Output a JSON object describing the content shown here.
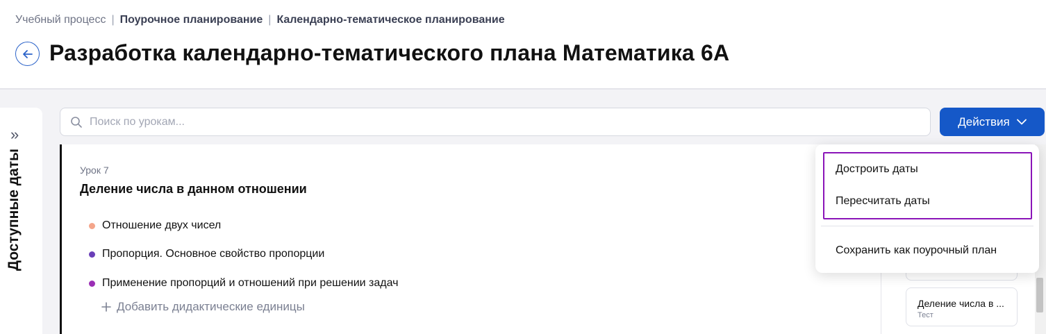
{
  "breadcrumb": {
    "items": [
      "Учебный процесс",
      "Поурочное планирование",
      "Календарно-тематическое планирование"
    ],
    "separator": "|"
  },
  "page": {
    "title": "Разработка календарно-тематического плана Математика 6А"
  },
  "sidebar": {
    "label": "Доступные даты",
    "expand_icon": "»"
  },
  "search": {
    "placeholder": "Поиск по урокам..."
  },
  "actions": {
    "label": "Действия",
    "menu": [
      "Достроить даты",
      "Пересчитать даты",
      "Сохранить как поурочный план"
    ]
  },
  "lesson": {
    "number": "Урок 7",
    "title": "Деление числа в данном отношении",
    "topics": [
      {
        "label": "Отношение двух чисел",
        "color": "#f4a58a"
      },
      {
        "label": "Пропорция. Основное свойство пропорции",
        "color": "#6a3fb8"
      },
      {
        "label": "Применение пропорций и отношений при решении задач",
        "color": "#9b2fb5"
      }
    ],
    "add_units": "Добавить дидактические единицы"
  },
  "right_panel": {
    "cards": [
      {
        "title": "Деление числа в ...",
        "subtitle": "Тест"
      }
    ]
  },
  "colors": {
    "accent": "#1558c8",
    "highlight": "#8a14b8"
  }
}
